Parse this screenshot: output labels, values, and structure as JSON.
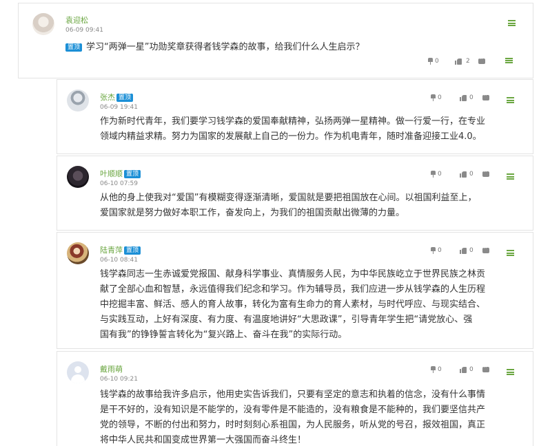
{
  "main_post": {
    "author": "袁迎松",
    "time": "06-09 09:41",
    "badge": "置顶",
    "title": "学习“两弹一星”功勋奖章获得者钱学森的故事，给我们什么人生启示？",
    "pin_count": "0",
    "like_count": "2",
    "avatar_icon": "user-photo-icon",
    "accent_color": "#6aa640"
  },
  "replies": [
    {
      "author": "张杰",
      "badge": "置顶",
      "time": "06-09 19:41",
      "pin_count": "0",
      "like_count": "0",
      "line1": "作为新时代青年，我们要学习钱学森的爱国奉献精神，弘扬两弹一星精神。做一行爱一行，在专业",
      "line2": "领域内精益求精。努力为国家的发展献上自己的一份力。作为机电青年，随时准备迎接工业4.0。"
    },
    {
      "author": "叶顺顺",
      "badge": "置顶",
      "time": "06-10 07:59",
      "pin_count": "0",
      "like_count": "0",
      "line1": "从他的身上使我对“爱国”有模糊变得逐渐清晰，爱国就是要把祖国放在心间。以祖国利益至上，",
      "line2": "爱国家就是努力做好本职工作，奋发向上，为我们的祖国贡献出微薄的力量。"
    },
    {
      "author": "陆青萍",
      "badge": "置顶",
      "time": "06-10 08:41",
      "pin_count": "0",
      "like_count": "0",
      "line1": "钱学森同志一生赤诚爱党报国、献身科学事业、真情服务人民，为中华民族屹立于世界民族之林贡",
      "line2": "献了全部心血和智慧，永远值得我们纪念和学习。作为辅导员，我们应进一步从钱学森的人生历程",
      "line3": "中挖掘丰富、鲜活、感人的育人故事，转化为富有生命力的育人素材，与时代呼应、与现实结合、",
      "line4": "与实践互动，上好有深度、有力度、有温度地讲好“大思政课”，引导青年学生把“请党放心、强",
      "line5": "国有我”的铮铮誓言转化为“复兴路上、奋斗在我”的实际行动。"
    },
    {
      "author": "戴雨萌",
      "time": "06-10 09:21",
      "pin_count": "0",
      "like_count": "0",
      "line1": "钱学森的故事给我许多启示，他用史实告诉我们，只要有坚定的意志和执着的信念，没有什么事情",
      "line2": "是干不好的，没有知识是不能学的，没有零件是不能造的，没有粮食是不能种的，我们要坚信共产",
      "line3": "党的领导，不断的付出和努力，时时刻刻心系祖国，为人民服务，听从党的号召，报效祖国，真正",
      "line4": "将中华人民共和国变成世界第一大强国而奋斗终生！"
    }
  ]
}
